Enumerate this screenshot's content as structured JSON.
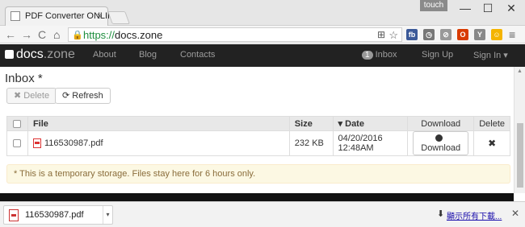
{
  "browser": {
    "tab_title": "PDF Converter ONLINE",
    "tab_close": "×",
    "profile": "touch",
    "window": {
      "minimize": "—",
      "maximize": "☐",
      "close": "✕"
    },
    "nav": {
      "back": "←",
      "forward": "→",
      "reload": "C",
      "home": "⌂"
    },
    "url_scheme": "https://",
    "url_host": "docs.zone",
    "omnibox_icons": {
      "translate": "⊞",
      "star": "☆"
    },
    "extensions": [
      {
        "name": "fb",
        "color": "#3b5998"
      },
      {
        "name": "◷",
        "color": "#777777"
      },
      {
        "name": "⊘",
        "color": "#999999"
      },
      {
        "name": "O",
        "color": "#d83b01"
      },
      {
        "name": "Y",
        "color": "#888888"
      },
      {
        "name": "☺",
        "color": "#f4b400"
      }
    ],
    "menu": "≡"
  },
  "site": {
    "logo_main": "docs",
    "logo_suffix": ".zone",
    "nav": {
      "about": "About",
      "blog": "Blog",
      "contacts": "Contacts",
      "inbox_count": "1",
      "inbox": "Inbox",
      "signup": "Sign Up",
      "signin": "Sign In ▾"
    }
  },
  "page": {
    "title": "Inbox *",
    "delete_label": "✖ Delete",
    "refresh_label": "⟳ Refresh",
    "table": {
      "headers": {
        "file": "File",
        "size": "Size",
        "date": "▾ Date",
        "download": "Download",
        "delete": "Delete"
      },
      "rows": [
        {
          "file": "116530987.pdf",
          "size": "232 KB",
          "date": "04/20/2016  12:48AM",
          "download": "Download",
          "delete": "✖"
        }
      ]
    },
    "notice": "* This is a temporary storage. Files stay here for 6 hours only."
  },
  "download_shelf": {
    "file": "116530987.pdf",
    "show_all": "顯示所有下載...",
    "show_all_icon": "⬇",
    "close": "✕",
    "caret": "▾"
  }
}
